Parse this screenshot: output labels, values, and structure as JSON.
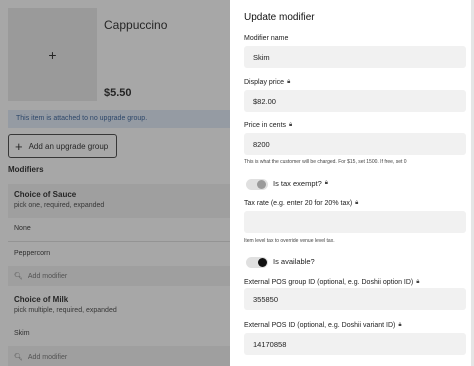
{
  "product": {
    "name": "Cappuccino",
    "image_placeholder": "+",
    "price": "$5.50"
  },
  "info_bar": "This item is attached to no upgrade group.",
  "add_group_button": {
    "icon": "+",
    "label": "Add an upgrade group"
  },
  "modifiers_label": "Modifiers",
  "groups": [
    {
      "title": "Choice of Sauce",
      "subtitle": "pick one, required, expanded",
      "options": [
        "None",
        "Peppercorn"
      ],
      "add_label": "Add modifier"
    },
    {
      "title": "Choice of Milk",
      "subtitle": "pick multiple, required, expanded",
      "options": [
        "Skim"
      ],
      "add_label": "Add modifier"
    }
  ],
  "drawer": {
    "title": "Update modifier",
    "fields": {
      "name": {
        "label": "Modifier name",
        "value": "Skim"
      },
      "display_price": {
        "label": "Display price",
        "value": "$82.00"
      },
      "price_cents": {
        "label": "Price in cents",
        "value": "8200",
        "help": "This is what the customer will be charged. For $15, set 1500. If free, set 0"
      },
      "tax_exempt": {
        "label": "Is tax exempt?",
        "on": false
      },
      "tax_rate": {
        "label": "Tax rate (e.g. enter 20 for 20% tax)",
        "value": "",
        "help": "Item level tax to override venue level tax."
      },
      "available": {
        "label": "Is available?",
        "on": true
      },
      "pos_group_id": {
        "label": "External POS group ID (optional, e.g. Doshii option ID)",
        "value": "355850"
      },
      "pos_id": {
        "label": "External POS ID (optional, e.g. Doshii variant ID)",
        "value": "14170858"
      }
    }
  }
}
